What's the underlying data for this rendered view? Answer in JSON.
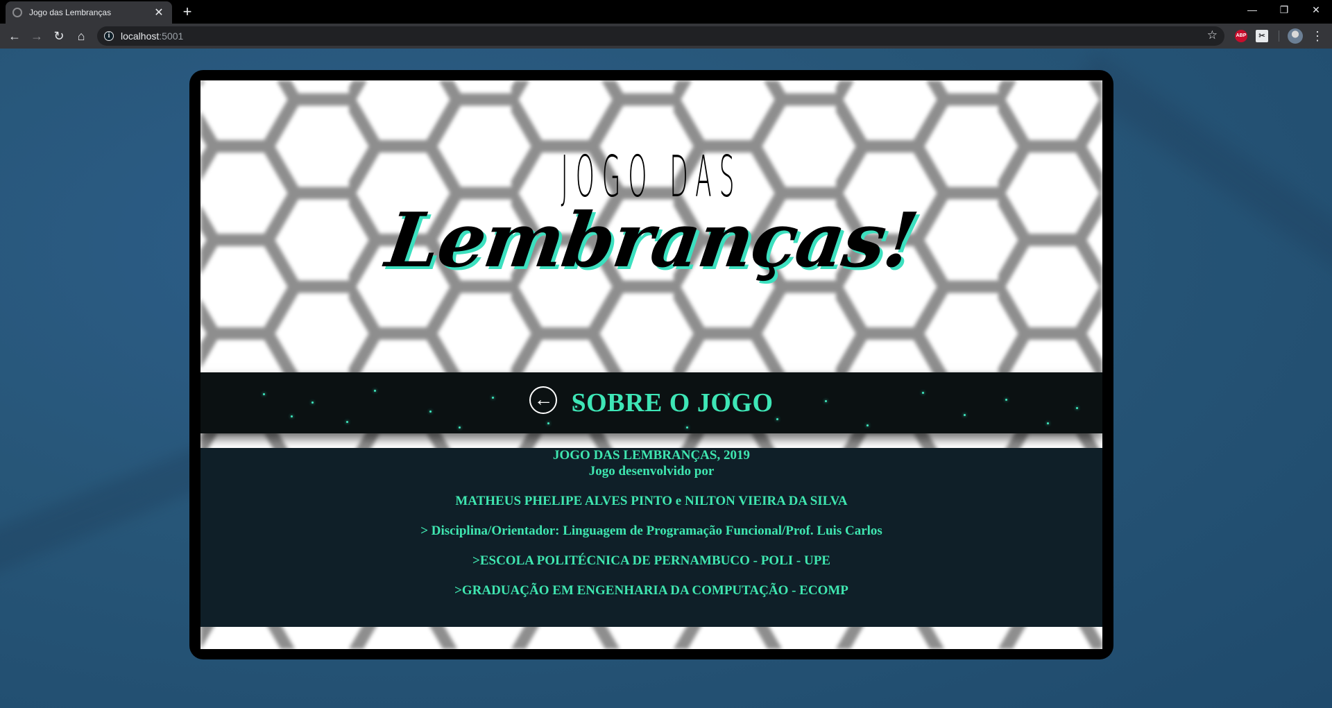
{
  "browser": {
    "tab_title": "Jogo das Lembranças",
    "tab_close": "✕",
    "new_tab": "+",
    "url_host": "localhost",
    "url_port": ":5001",
    "window_controls": {
      "minimize": "—",
      "restore": "❐",
      "close": "✕"
    },
    "extensions": {
      "abp": "ABP",
      "screenshot": "✂"
    }
  },
  "page": {
    "logo_top": "JOGO DAS",
    "logo_main": "Lembranças!",
    "section_title": "SOBRE O JOGO",
    "back_icon": "←",
    "info": {
      "line1": "JOGO DAS LEMBRANÇAS, 2019",
      "line2": "Jogo desenvolvido por",
      "line3": "MATHEUS PHELIPE ALVES PINTO e NILTON VIEIRA DA SILVA",
      "line4": "> Disciplina/Orientador: Linguagem de Programação Funcional/Prof. Luis Carlos",
      "line5": ">ESCOLA POLITÉCNICA DE PERNAMBUCO - POLI - UPE",
      "line6": ">GRADUAÇÃO EM ENGENHARIA DA COMPUTAÇÃO - ECOMP"
    }
  },
  "colors": {
    "accent": "#3ee6b6",
    "info_bg": "#0f1f28",
    "banner_bg": "#0b1112",
    "desktop_bg": "#275678"
  }
}
